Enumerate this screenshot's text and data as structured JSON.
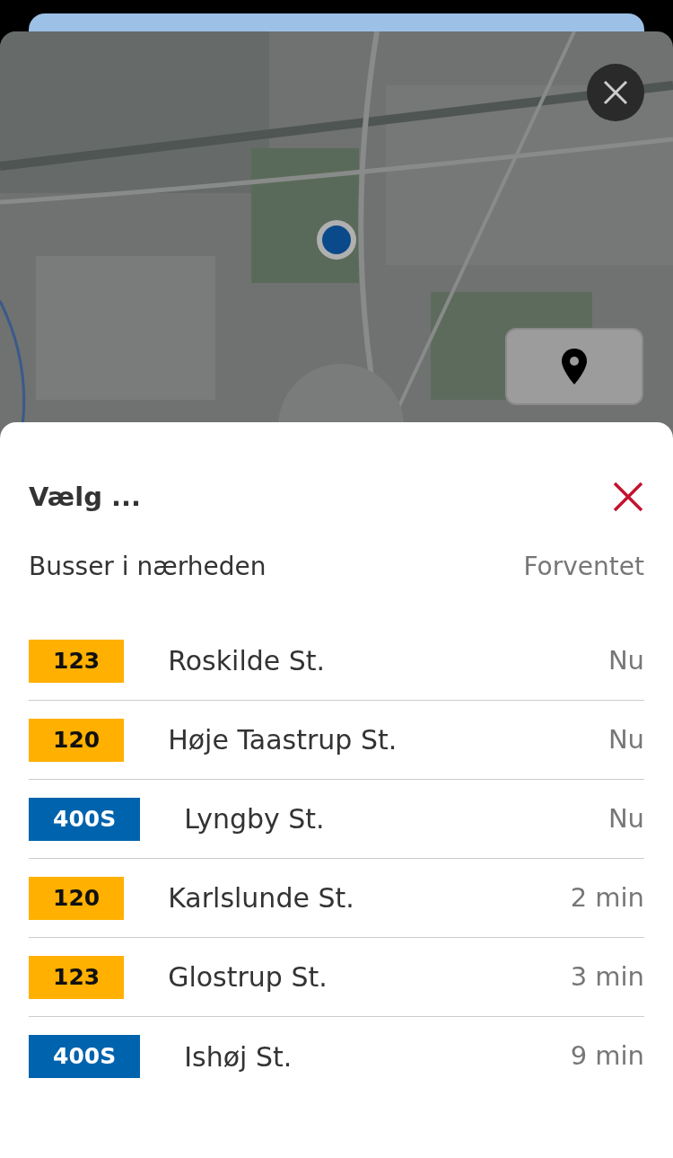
{
  "sheet": {
    "title": "Vælg ...",
    "list_label": "Busser i nærheden",
    "time_label": "Forventet"
  },
  "departures": [
    {
      "line": "123",
      "color": "#ffb000",
      "destination": "Roskilde St.",
      "time": "Nu"
    },
    {
      "line": "120",
      "color": "#ffb000",
      "destination": "Høje Taastrup St.",
      "time": "Nu"
    },
    {
      "line": "400S",
      "color": "#0063ad",
      "destination": "Lyngby St.",
      "time": "Nu"
    },
    {
      "line": "120",
      "color": "#ffb000",
      "destination": "Karlslunde St.",
      "time": "2 min"
    },
    {
      "line": "123",
      "color": "#ffb000",
      "destination": "Glostrup St.",
      "time": "3 min"
    },
    {
      "line": "400S",
      "color": "#0063ad",
      "destination": "Ishøj St.",
      "time": "9 min"
    }
  ]
}
